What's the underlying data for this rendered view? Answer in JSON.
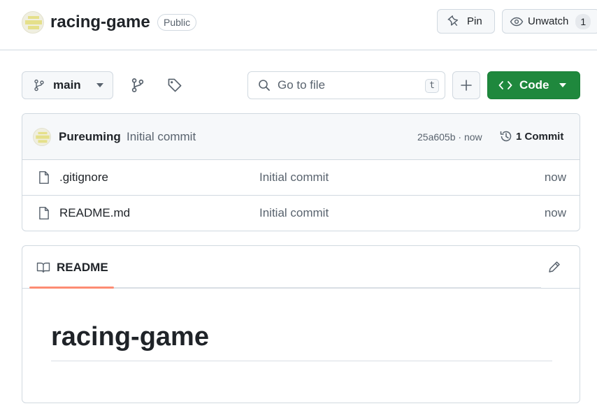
{
  "header": {
    "repo_name": "racing-game",
    "visibility": "Public",
    "pin_label": "Pin",
    "watch_label": "Unwatch",
    "watch_count": "1"
  },
  "toolbar": {
    "branch": "main",
    "search_placeholder": "Go to file",
    "search_shortcut": "t",
    "code_label": "Code"
  },
  "latest_commit": {
    "author": "Pureuming",
    "message": "Initial commit",
    "hash_time": "25a605b · now",
    "commit_count": "1 Commit"
  },
  "files": [
    {
      "name": ".gitignore",
      "commit": "Initial commit",
      "time": "now"
    },
    {
      "name": "README.md",
      "commit": "Initial commit",
      "time": "now"
    }
  ],
  "readme": {
    "tab_label": "README",
    "heading": "racing-game"
  },
  "colors": {
    "accent_green": "#1f883d",
    "tab_underline": "#fd8c73",
    "border": "#d1d9e0",
    "muted_text": "#59636e"
  },
  "icons": {
    "owner_avatar": "identicon-avatar",
    "pin": "pin-icon",
    "watch": "eye-icon",
    "branch": "git-branch-icon",
    "tags": "tag-icon",
    "search": "search-icon",
    "add": "plus-icon",
    "code": "code-icon",
    "history": "history-icon",
    "file": "file-icon",
    "readme": "book-icon",
    "edit": "pencil-icon"
  }
}
